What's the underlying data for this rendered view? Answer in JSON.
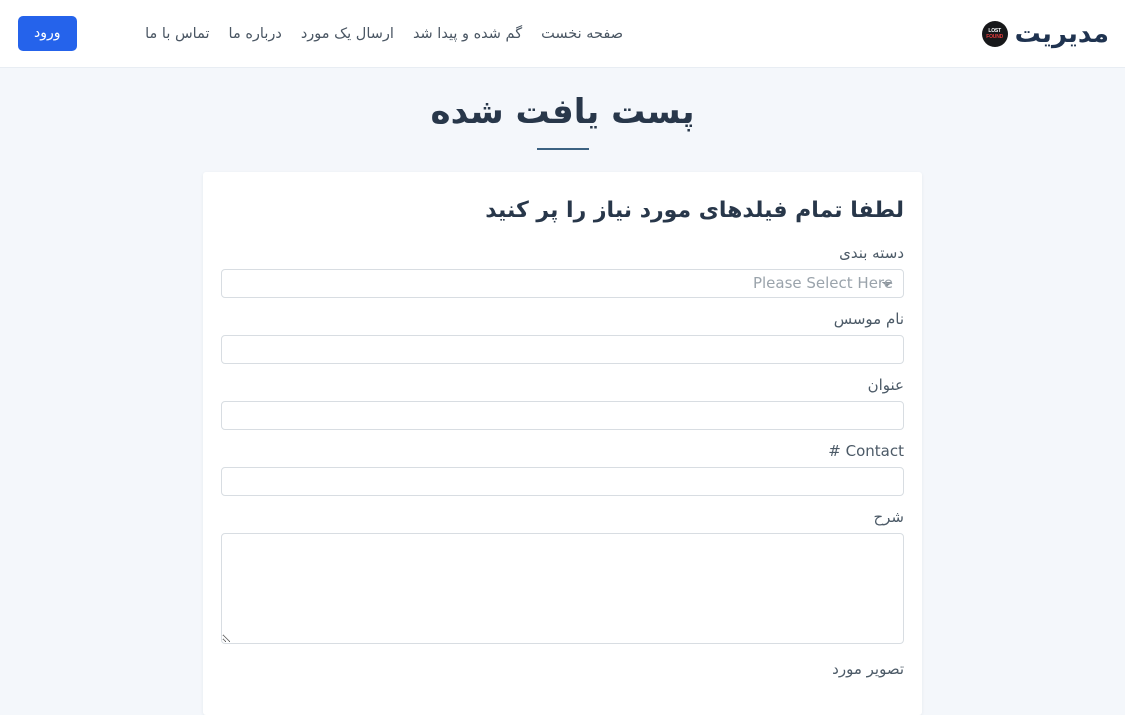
{
  "header": {
    "brand": {
      "name": "مدیریت",
      "badge_line1": "LOST",
      "badge_line2": "FOUND",
      "icon": "lost-found-badge-icon"
    },
    "nav": [
      {
        "label": "صفحه نخست"
      },
      {
        "label": "گم شده و پیدا شد"
      },
      {
        "label": "ارسال یک مورد"
      },
      {
        "label": "درباره ما"
      },
      {
        "label": "تماس با ما"
      }
    ],
    "login_label": "ورود"
  },
  "page": {
    "title": "پست یافت شده"
  },
  "form": {
    "heading": "لطفا تمام فیلدهای مورد نیاز را پر کنید",
    "fields": [
      {
        "label": "دسته بندی",
        "type": "select",
        "value": "",
        "placeholder": "Please Select Here",
        "options": [
          "Please Select Here"
        ]
      },
      {
        "label": "نام موسس",
        "type": "text",
        "value": "",
        "placeholder": ""
      },
      {
        "label": "عنوان",
        "type": "text",
        "value": "",
        "placeholder": ""
      },
      {
        "label": "# Contact",
        "type": "text",
        "value": "",
        "placeholder": ""
      },
      {
        "label": "شرح",
        "type": "textarea",
        "value": "",
        "placeholder": ""
      },
      {
        "label": "تصویر مورد",
        "type": "file",
        "value": "",
        "placeholder": ""
      }
    ]
  },
  "colors": {
    "accent": "#2563eb",
    "page_background": "#f4f7fb",
    "title": "#28374a",
    "rule": "#3c6282"
  }
}
